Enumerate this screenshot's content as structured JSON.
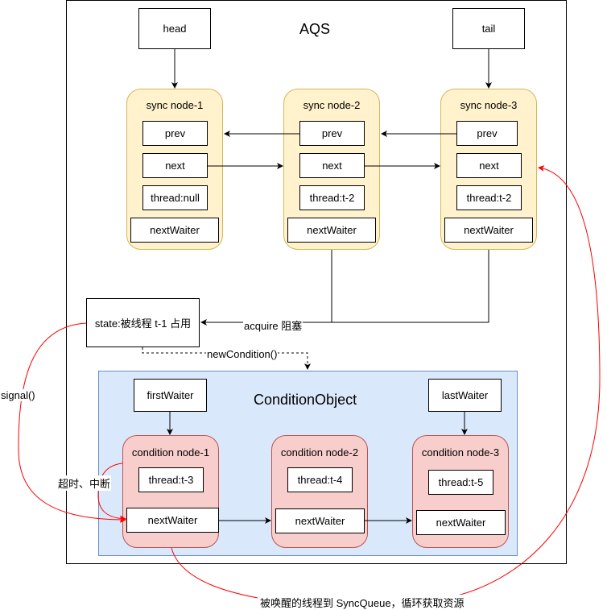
{
  "aqs": {
    "title": "AQS",
    "head_label": "head",
    "tail_label": "tail",
    "state_label": "state:被线程 t-1 占用",
    "sync_nodes": [
      {
        "title": "sync node-1",
        "prev": "prev",
        "next": "next",
        "thread": "thread:null",
        "next_waiter": "nextWaiter"
      },
      {
        "title": "sync node-2",
        "prev": "prev",
        "next": "next",
        "thread": "thread:t-2",
        "next_waiter": "nextWaiter"
      },
      {
        "title": "sync node-3",
        "prev": "prev",
        "next": "next",
        "thread": "thread:t-2",
        "next_waiter": "nextWaiter"
      }
    ]
  },
  "condition_object": {
    "title": "ConditionObject",
    "first_waiter_label": "firstWaiter",
    "last_waiter_label": "lastWaiter",
    "nodes": [
      {
        "title": "condition node-1",
        "thread": "thread:t-3",
        "next_waiter": "nextWaiter"
      },
      {
        "title": "condition node-2",
        "thread": "thread:t-4",
        "next_waiter": "nextWaiter"
      },
      {
        "title": "condition node-3",
        "thread": "thread:t-5",
        "next_waiter": "nextWaiter"
      }
    ]
  },
  "edges": {
    "acquire_label": "acquire 阻塞",
    "new_condition_label": "newCondition()",
    "signal_label": "signal()",
    "timeout_interrupt_label": "超时、中断",
    "wakeup_label": "被唤醒的线程到 SyncQueue，循环获取资源"
  },
  "colors": {
    "sync_fill": "#fff2cc",
    "sync_stroke": "#d6b656",
    "cond_fill": "#f8cecc",
    "cond_stroke": "#b85450",
    "condobj_fill": "#dae8fc",
    "condobj_stroke": "#6c8ebf",
    "red_edge": "#ff0000"
  }
}
